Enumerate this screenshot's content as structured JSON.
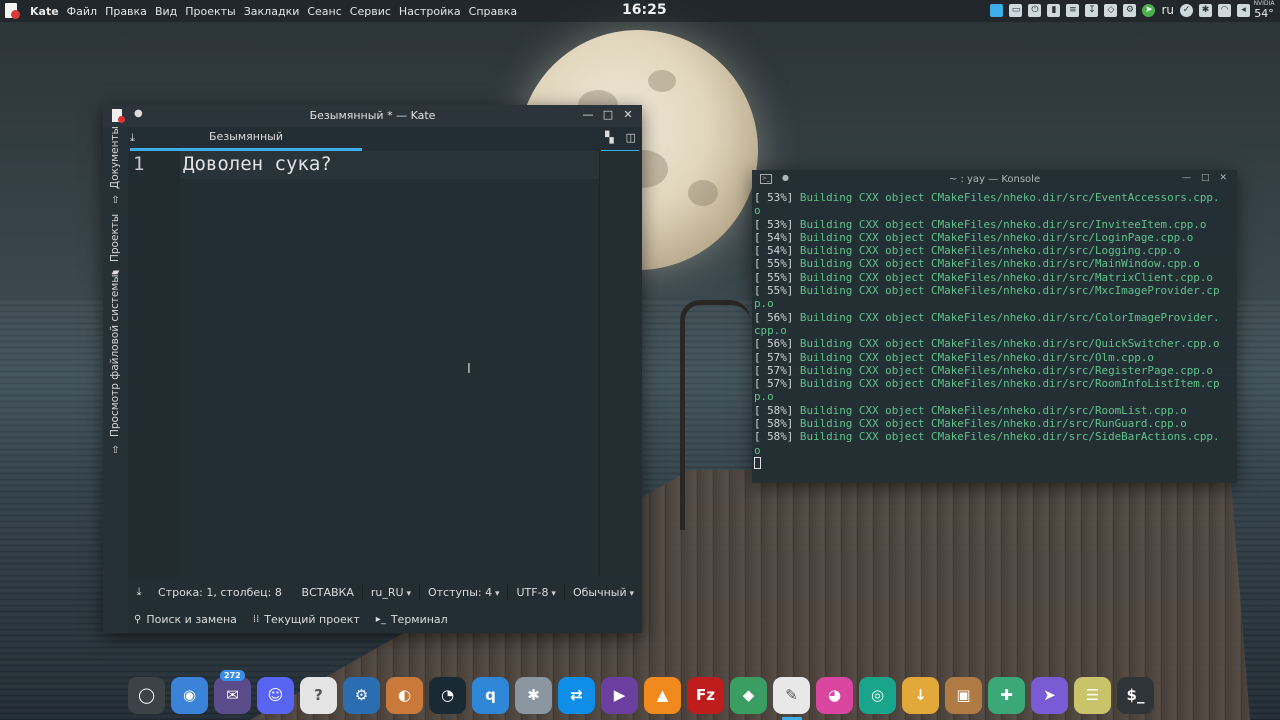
{
  "panel": {
    "menu": [
      "Kate",
      "Файл",
      "Правка",
      "Вид",
      "Проекты",
      "Закладки",
      "Сеанс",
      "Сервис",
      "Настройка",
      "Справка"
    ],
    "clock": "16:25",
    "tray_lang": "ru",
    "gpu_label": "NVIDIA",
    "temperature": "54°"
  },
  "kate": {
    "title": "Безымянный * — Kate",
    "tab_label": "Безымянный",
    "side_tabs": [
      "Документы",
      "Проекты",
      "Просмотр файловой системы"
    ],
    "line_number": "1",
    "code": "Доволен сука?",
    "status": {
      "position": "Строка: 1, столбец: 8",
      "mode": "ВСТАВКА",
      "dictionary": "ru_RU",
      "indent": "Отступы: 4",
      "encoding": "UTF-8",
      "highlight": "Обычный"
    },
    "bottom_tools": [
      "Поиск и замена",
      "Текущий проект",
      "Терминал"
    ]
  },
  "konsole": {
    "title": "~ : yay — Konsole",
    "lines": [
      {
        "pct": "[ 53%]",
        "text": " Building CXX object CMakeFiles/nheko.dir/src/EventAccessors.cpp."
      },
      {
        "pct": "",
        "text": "o"
      },
      {
        "pct": "[ 53%]",
        "text": " Building CXX object CMakeFiles/nheko.dir/src/InviteeItem.cpp.o"
      },
      {
        "pct": "[ 54%]",
        "text": " Building CXX object CMakeFiles/nheko.dir/src/LoginPage.cpp.o"
      },
      {
        "pct": "[ 54%]",
        "text": " Building CXX object CMakeFiles/nheko.dir/src/Logging.cpp.o"
      },
      {
        "pct": "[ 55%]",
        "text": " Building CXX object CMakeFiles/nheko.dir/src/MainWindow.cpp.o"
      },
      {
        "pct": "[ 55%]",
        "text": " Building CXX object CMakeFiles/nheko.dir/src/MatrixClient.cpp.o"
      },
      {
        "pct": "[ 55%]",
        "text": " Building CXX object CMakeFiles/nheko.dir/src/MxcImageProvider.cp"
      },
      {
        "pct": "",
        "text": "p.o"
      },
      {
        "pct": "[ 56%]",
        "text": " Building CXX object CMakeFiles/nheko.dir/src/ColorImageProvider."
      },
      {
        "pct": "",
        "text": "cpp.o"
      },
      {
        "pct": "[ 56%]",
        "text": " Building CXX object CMakeFiles/nheko.dir/src/QuickSwitcher.cpp.o"
      },
      {
        "pct": "[ 57%]",
        "text": " Building CXX object CMakeFiles/nheko.dir/src/Olm.cpp.o"
      },
      {
        "pct": "[ 57%]",
        "text": " Building CXX object CMakeFiles/nheko.dir/src/RegisterPage.cpp.o"
      },
      {
        "pct": "[ 57%]",
        "text": " Building CXX object CMakeFiles/nheko.dir/src/RoomInfoListItem.cp"
      },
      {
        "pct": "",
        "text": "p.o"
      },
      {
        "pct": "[ 58%]",
        "text": " Building CXX object CMakeFiles/nheko.dir/src/RoomList.cpp.o"
      },
      {
        "pct": "[ 58%]",
        "text": " Building CXX object CMakeFiles/nheko.dir/src/RunGuard.cpp.o"
      },
      {
        "pct": "[ 58%]",
        "text": " Building CXX object CMakeFiles/nheko.dir/src/SideBarActions.cpp."
      },
      {
        "pct": "",
        "text": "o"
      }
    ]
  },
  "dock": {
    "items": [
      {
        "icon": "cinnamon-ring-icon",
        "color": "#3b4347",
        "glyph": "◯"
      },
      {
        "icon": "chromium-icon",
        "color": "#3b82d9",
        "glyph": "◉"
      },
      {
        "icon": "mail-icon",
        "color": "#5a4b8a",
        "glyph": "✉",
        "badge": "272"
      },
      {
        "icon": "discord-icon",
        "color": "#5865f2",
        "glyph": "☺"
      },
      {
        "icon": "unknown-file-icon",
        "color": "#e4e4e4",
        "glyph": "?"
      },
      {
        "icon": "steam-icon",
        "color": "#2a6db0",
        "glyph": "⚙"
      },
      {
        "icon": "gimp-icon",
        "color": "#c97a3b",
        "glyph": "◐"
      },
      {
        "icon": "osu-icon",
        "color": "#1a2a35",
        "glyph": "◔"
      },
      {
        "icon": "qbittorrent-icon",
        "color": "#2d86d6",
        "glyph": "q"
      },
      {
        "icon": "bluetooth-icon",
        "color": "#8a96a0",
        "glyph": "✱"
      },
      {
        "icon": "teamviewer-icon",
        "color": "#0e8ee9",
        "glyph": "⇄"
      },
      {
        "icon": "media-player-icon",
        "color": "#6b3fa0",
        "glyph": "▶"
      },
      {
        "icon": "vlc-icon",
        "color": "#f08a1c",
        "glyph": "▲"
      },
      {
        "icon": "filezilla-icon",
        "color": "#bf1d1d",
        "glyph": "Fz"
      },
      {
        "icon": "layers-icon",
        "color": "#3a9e62",
        "glyph": "◆"
      },
      {
        "icon": "kate-icon",
        "color": "#e8e8e8",
        "glyph": "✎",
        "active": true
      },
      {
        "icon": "color-picker-icon",
        "color": "#d946a0",
        "glyph": "◕"
      },
      {
        "icon": "camera-icon",
        "color": "#19a58b",
        "glyph": "◎"
      },
      {
        "icon": "download-icon",
        "color": "#e3a83a",
        "glyph": "↓"
      },
      {
        "icon": "package-icon",
        "color": "#b07a45",
        "glyph": "▣"
      },
      {
        "icon": "settings-wrench-icon",
        "color": "#3aa877",
        "glyph": "✚"
      },
      {
        "icon": "cursor-icon",
        "color": "#7a5bd6",
        "glyph": "➤"
      },
      {
        "icon": "archive-icon",
        "color": "#c9c46a",
        "glyph": "☰"
      },
      {
        "icon": "terminal-icon",
        "color": "#2f3438",
        "glyph": "$_"
      }
    ]
  }
}
